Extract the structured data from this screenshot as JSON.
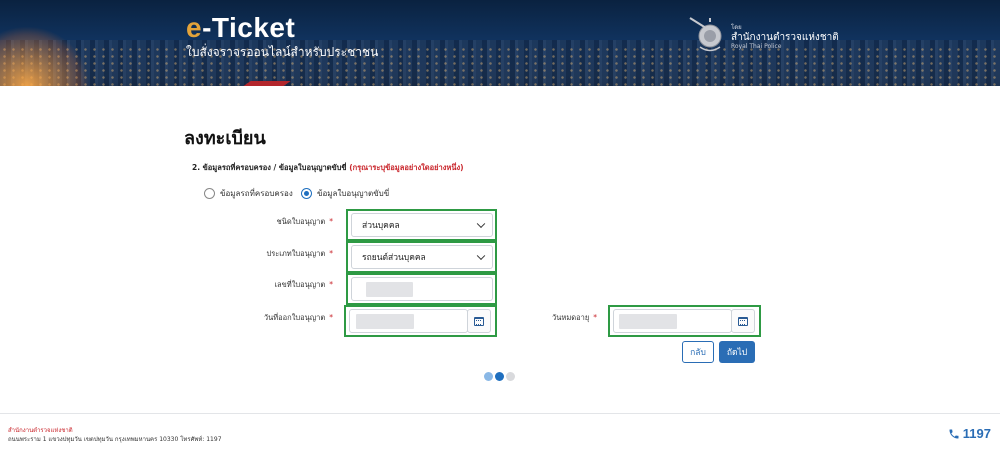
{
  "header": {
    "brand_prefix": "e",
    "brand_rest": "-Ticket",
    "subtitle": "ใบสั่งจราจรออนไลน์สำหรับประชาชน",
    "agency_small": "โดย",
    "agency_name": "สำนักงานตำรวจแห่งชาติ",
    "agency_en": "Royal Thai Police"
  },
  "page": {
    "title": "ลงทะเบียน",
    "section_label": "2. ข้อมูลรถที่ครอบครอง / ข้อมูลใบอนุญาตขับขี่",
    "section_hint": "(กรุณาระบุข้อมูลอย่างใดอย่างหนึ่ง)"
  },
  "radios": {
    "option_vehicle": "ข้อมูลรถที่ครอบครอง",
    "option_license": "ข้อมูลใบอนุญาตขับขี่",
    "selected": "option_license"
  },
  "form": {
    "license_category_label": "ชนิดใบอนุญาต",
    "license_category_value": "ส่วนบุคคล",
    "license_type_label": "ประเภทใบอนุญาต",
    "license_type_value": "รถยนต์ส่วนบุคคล",
    "license_number_label": "เลขที่ใบอนุญาต",
    "issue_date_label": "วันที่ออกใบอนุญาต",
    "expiry_date_label": "วันหมดอายุ",
    "required_mark": "*"
  },
  "buttons": {
    "back": "กลับ",
    "next": "ถัดไป"
  },
  "steps": {
    "total": 3,
    "current": 2,
    "colors": [
      "#8ab8e6",
      "#1f6fbf",
      "#d9dadd"
    ]
  },
  "footer": {
    "org": "สำนักงานตำรวจแห่งชาติ",
    "address": "ถนนพระราม 1 แขวงปทุมวัน เขตปทุมวัน กรุงเทพมหานคร 10330 โทรศัพท์: 1197",
    "phone": "1197"
  },
  "colors": {
    "accent": "#2a6db5",
    "required": "#c9252b",
    "highlight_frame": "#2e9a44",
    "brand_orange": "#e3a33a"
  }
}
